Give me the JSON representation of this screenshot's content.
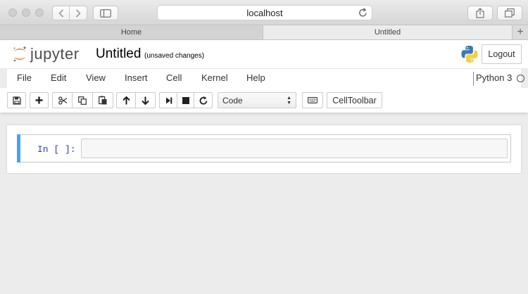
{
  "browser": {
    "url": "localhost",
    "tabs": [
      {
        "label": "Home"
      },
      {
        "label": "Untitled"
      }
    ]
  },
  "header": {
    "logo_text": "jupyter",
    "notebook_name": "Untitled",
    "save_status": "(unsaved changes)",
    "logout_label": "Logout"
  },
  "menubar": {
    "items": [
      "File",
      "Edit",
      "View",
      "Insert",
      "Cell",
      "Kernel",
      "Help"
    ],
    "kernel_name": "Python 3"
  },
  "toolbar": {
    "cell_type": "Code",
    "celltoolbar_label": "CellToolbar",
    "icons": [
      "save-icon",
      "plus-icon",
      "cut-icon",
      "copy-icon",
      "paste-icon",
      "arrow-up-icon",
      "arrow-down-icon",
      "step-forward-icon",
      "stop-icon",
      "refresh-icon",
      "keyboard-icon"
    ]
  },
  "cell": {
    "prompt": "In [ ]:",
    "content": ""
  },
  "colors": {
    "cell_selected_bar": "#42a5f5",
    "prompt": "#303f9f",
    "jupyter_orange": "#f37726"
  }
}
